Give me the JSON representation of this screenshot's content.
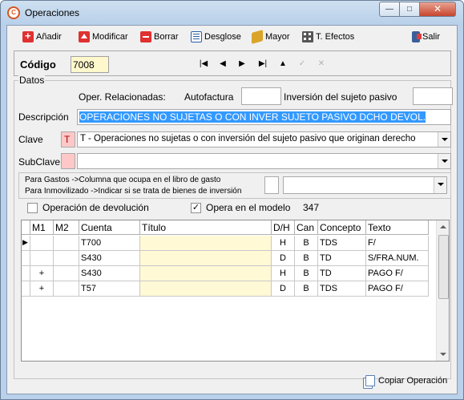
{
  "window": {
    "title": "Operaciones",
    "icon": "app-logo-icon",
    "controls": [
      "minimize-icon",
      "maximize-icon",
      "close-icon"
    ]
  },
  "toolbar": {
    "add": "Añadir",
    "edit": "Modificar",
    "delete": "Borrar",
    "breakdown": "Desglose",
    "ledger": "Mayor",
    "effects": "T. Efectos",
    "exit": "Salir"
  },
  "record": {
    "code_label": "Código",
    "code_value": "7008",
    "nav": [
      "first-record-icon",
      "previous-record-icon",
      "next-record-icon",
      "last-record-icon",
      "insert-record-icon",
      "confirm-record-icon",
      "cancel-record-icon"
    ]
  },
  "datos": {
    "legend": "Datos",
    "related_label": "Oper. Relacionadas:",
    "autofactura_label": "Autofactura",
    "autofactura_value": "",
    "inversion_label": "Inversión del sujeto pasivo",
    "inversion_value": "",
    "descripcion_label": "Descripción",
    "descripcion_value": "OPERACIONES NO SUJETAS O CON INVER SUJETO PASIVO DCHO DEVOL.",
    "clave_label": "Clave",
    "clave_code": "T",
    "clave_value": "T - Operaciones no sujetas o con inversión del sujeto pasivo que originan derecho",
    "subclave_label": "SubClave",
    "subclave_code": "",
    "subclave_value": "",
    "hint_line1": "Para Gastos ->Columna que ocupa en el libro de gasto",
    "hint_line2": "Para Inmovilizado ->Indicar si se trata de bienes de inversión",
    "hint_code": "",
    "hint_select": "",
    "devolucion_label": "Operación de devolución",
    "devolucion_checked": false,
    "modelo_label": "Opera en el modelo",
    "modelo_checked": true,
    "modelo_value": "347"
  },
  "grid": {
    "columns": [
      "M1",
      "M2",
      "Cuenta",
      "Título",
      "D/H",
      "Can",
      "Concepto",
      "Texto"
    ],
    "rows": [
      {
        "indicator": "▶",
        "m1": "",
        "m2": "",
        "cuenta": "T700",
        "titulo": "",
        "dh": "H",
        "can": "B",
        "concepto": "TDS",
        "texto": "F/"
      },
      {
        "indicator": "",
        "m1": "",
        "m2": "",
        "cuenta": "S430",
        "titulo": "",
        "dh": "D",
        "can": "B",
        "concepto": "TD",
        "texto": "S/FRA.NUM."
      },
      {
        "indicator": "",
        "m1": "+",
        "m2": "",
        "cuenta": "S430",
        "titulo": "",
        "dh": "H",
        "can": "B",
        "concepto": "TD",
        "texto": "PAGO F/"
      },
      {
        "indicator": "",
        "m1": "+",
        "m2": "",
        "cuenta": "T57",
        "titulo": "",
        "dh": "D",
        "can": "B",
        "concepto": "TDS",
        "texto": "PAGO F/"
      }
    ]
  },
  "footer": {
    "copy_label": "Copiar Operación"
  }
}
